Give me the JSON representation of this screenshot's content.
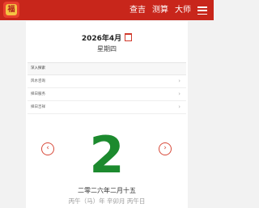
{
  "header": {
    "logo_text": "福",
    "nav": [
      "查吉",
      "测算",
      "大师"
    ],
    "menu_icon": "hamburger-icon"
  },
  "date": {
    "title": "2026年4月",
    "weekday": "星期四"
  },
  "panel": {
    "title": "深入探索",
    "items": [
      "风水咨询",
      "择日服务",
      "择日吉祥"
    ]
  },
  "day": {
    "number": "2",
    "lunar": "二零二六年二月十五",
    "ganzhi": "丙午（马）年 辛卯月 丙午日"
  },
  "colors": {
    "brand_red": "#c8261b",
    "day_green": "#1c8a2e",
    "arrow_red": "#d84a3a"
  }
}
